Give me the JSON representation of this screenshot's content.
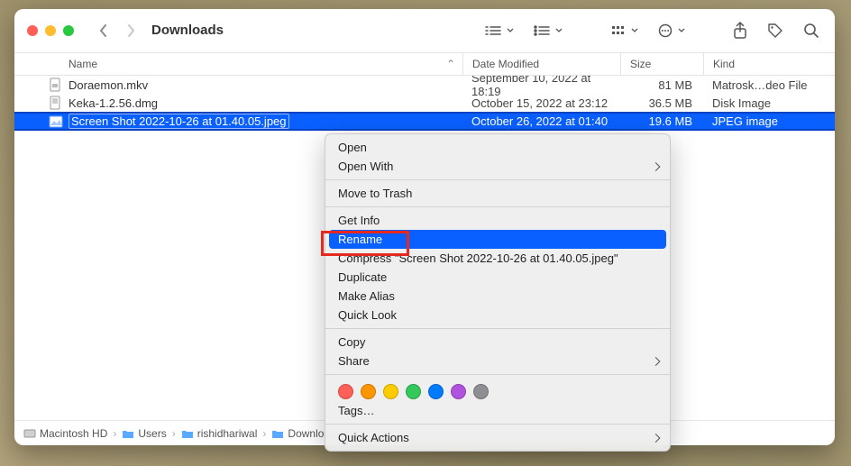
{
  "window": {
    "title": "Downloads"
  },
  "columns": {
    "name": "Name",
    "date": "Date Modified",
    "size": "Size",
    "kind": "Kind"
  },
  "files": [
    {
      "name": "Doraemon.mkv",
      "date": "September 10, 2022 at 18:19",
      "size": "81 MB",
      "kind": "Matrosk…deo File",
      "icon": "video"
    },
    {
      "name": "Keka-1.2.56.dmg",
      "date": "October 15, 2022 at 23:12",
      "size": "36.5 MB",
      "kind": "Disk Image",
      "icon": "dmg"
    },
    {
      "name": "Screen Shot 2022-10-26 at 01.40.05.jpeg",
      "date": "October 26, 2022 at 01:40",
      "size": "19.6 MB",
      "kind": "JPEG image",
      "icon": "img",
      "selected": true
    }
  ],
  "path": [
    {
      "label": "Macintosh HD",
      "icon": "disk"
    },
    {
      "label": "Users",
      "icon": "folder"
    },
    {
      "label": "rishidhariwal",
      "icon": "folder"
    },
    {
      "label": "Downloa…",
      "icon": "folder"
    }
  ],
  "menu": {
    "open": "Open",
    "openwith": "Open With",
    "trash": "Move to Trash",
    "getinfo": "Get Info",
    "rename": "Rename",
    "compress": "Compress \"Screen Shot 2022-10-26 at 01.40.05.jpeg\"",
    "duplicate": "Duplicate",
    "alias": "Make Alias",
    "quicklook": "Quick Look",
    "copy": "Copy",
    "share": "Share",
    "tags": "Tags…",
    "quickactions": "Quick Actions"
  },
  "tagColors": [
    "#ff5f57",
    "#ff9500",
    "#ffcc00",
    "#34c759",
    "#007aff",
    "#af52de",
    "#8e8e93"
  ]
}
